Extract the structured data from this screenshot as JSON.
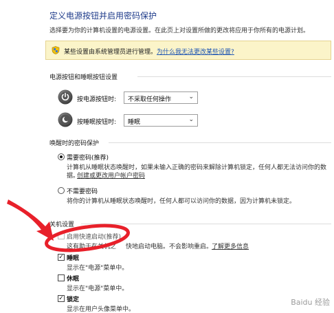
{
  "header": {
    "title": "定义电源按钮并启用密码保护",
    "subtitle": "选择要为你的计算机设置的电源设置。在此页上对设置所做的更改将应用于你所有的电源计划。"
  },
  "infobar": {
    "text": "某些设置由系统管理员进行管理。",
    "link": "为什么我无法更改某些设置?"
  },
  "power_buttons": {
    "heading": "电源按钮和睡眠按钮设置",
    "power_label": "按电源按钮时:",
    "power_value": "不采取任何操作",
    "sleep_label": "按睡眠按钮时:",
    "sleep_value": "睡眠"
  },
  "wake_password": {
    "heading": "唤醒时的密码保护",
    "require_label": "需要密码(推荐)",
    "require_desc_1": "计算机从睡眠状态唤醒时，如果未输入正确的密码来解除计算机锁定，任何人都无法访问你的数",
    "require_desc_2": "据。",
    "require_link": "创建或更改用户帐户密码",
    "noreq_label": "不需要密码",
    "noreq_desc": "将你的计算机从睡眠状态唤醒时，任何人都可以访问你的数据，因为计算机未锁定。"
  },
  "shutdown": {
    "heading": "关机设置",
    "fast_label": "启用快速启动(推荐)",
    "fast_desc_a": "这有助于在关机之",
    "fast_desc_b": "快地启动电脑。不会影响重启。",
    "fast_link": "了解更多信息",
    "sleep_label": "睡眠",
    "sleep_desc": "显示在\"电源\"菜单中。",
    "hibernate_label": "休眠",
    "hibernate_desc": "显示在\"电源\"菜单中。",
    "lock_label": "锁定",
    "lock_desc": "显示在用户头像菜单中。"
  },
  "watermark": "Baidu 经验",
  "colors": {
    "title": "#1e3b8a",
    "link": "#1b53b3",
    "infobar_bg": "#fbf4c9",
    "annotation": "#e8202a"
  },
  "checked": {
    "require_password": true,
    "no_password": false,
    "fast_startup": false,
    "sleep": true,
    "hibernate": false,
    "lock": true
  }
}
